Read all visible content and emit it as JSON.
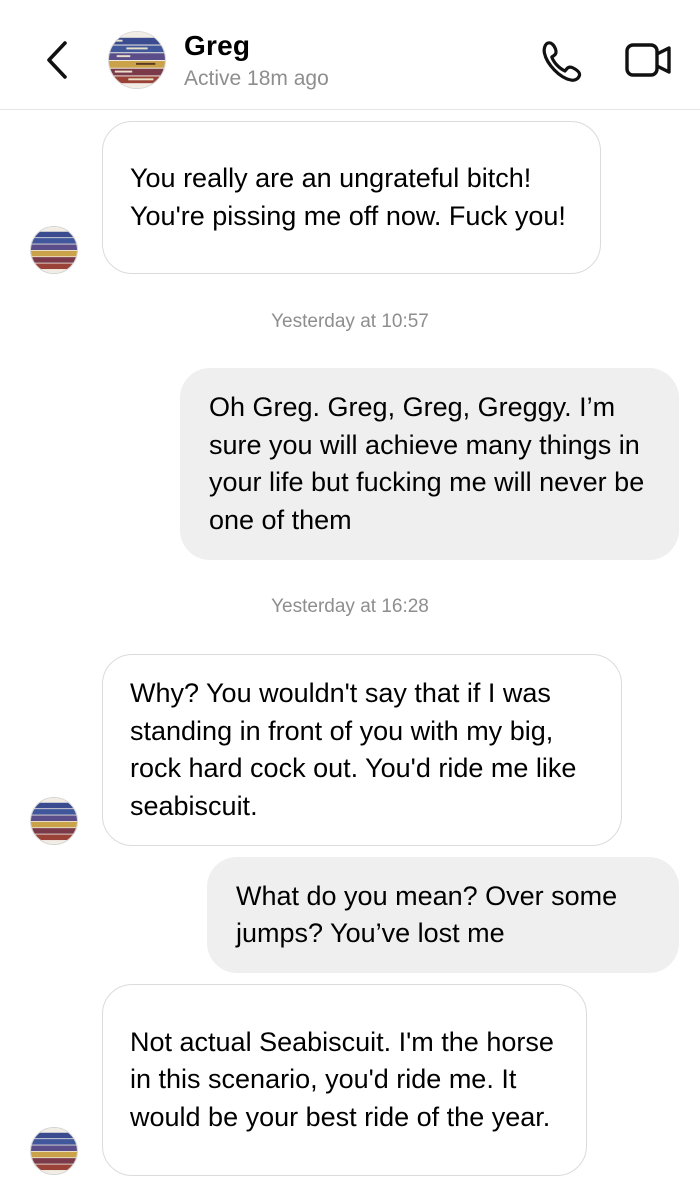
{
  "header": {
    "contact_name": "Greg",
    "status": "Active 18m ago",
    "back_icon": "chevron-left-icon",
    "call_icon": "phone-icon",
    "video_icon": "video-camera-icon"
  },
  "colors": {
    "incoming_bubble_border": "#dbdbdb",
    "outgoing_bubble_bg": "#efefef",
    "secondary_text": "#8e8e8e"
  },
  "messages": [
    {
      "direction": "incoming",
      "text": "You really are an ungrateful bitch! You're pissing me off now. Fuck you!"
    },
    {
      "timestamp": "Yesterday at 10:57"
    },
    {
      "direction": "outgoing",
      "text": "Oh Greg. Greg, Greg, Greggy. I’m sure you will achieve many things in your life but fucking me will never be one of them"
    },
    {
      "timestamp": "Yesterday at 16:28"
    },
    {
      "direction": "incoming",
      "text": "Why? You wouldn't say that if I was standing in front of you with my big, rock hard cock out. You'd ride me like seabiscuit."
    },
    {
      "direction": "outgoing",
      "text": "What do you mean? Over some jumps? You’ve lost me"
    },
    {
      "direction": "incoming",
      "text": "Not actual Seabiscuit. I'm the horse in this scenario, you'd ride me. It would be your best ride of the year."
    }
  ]
}
